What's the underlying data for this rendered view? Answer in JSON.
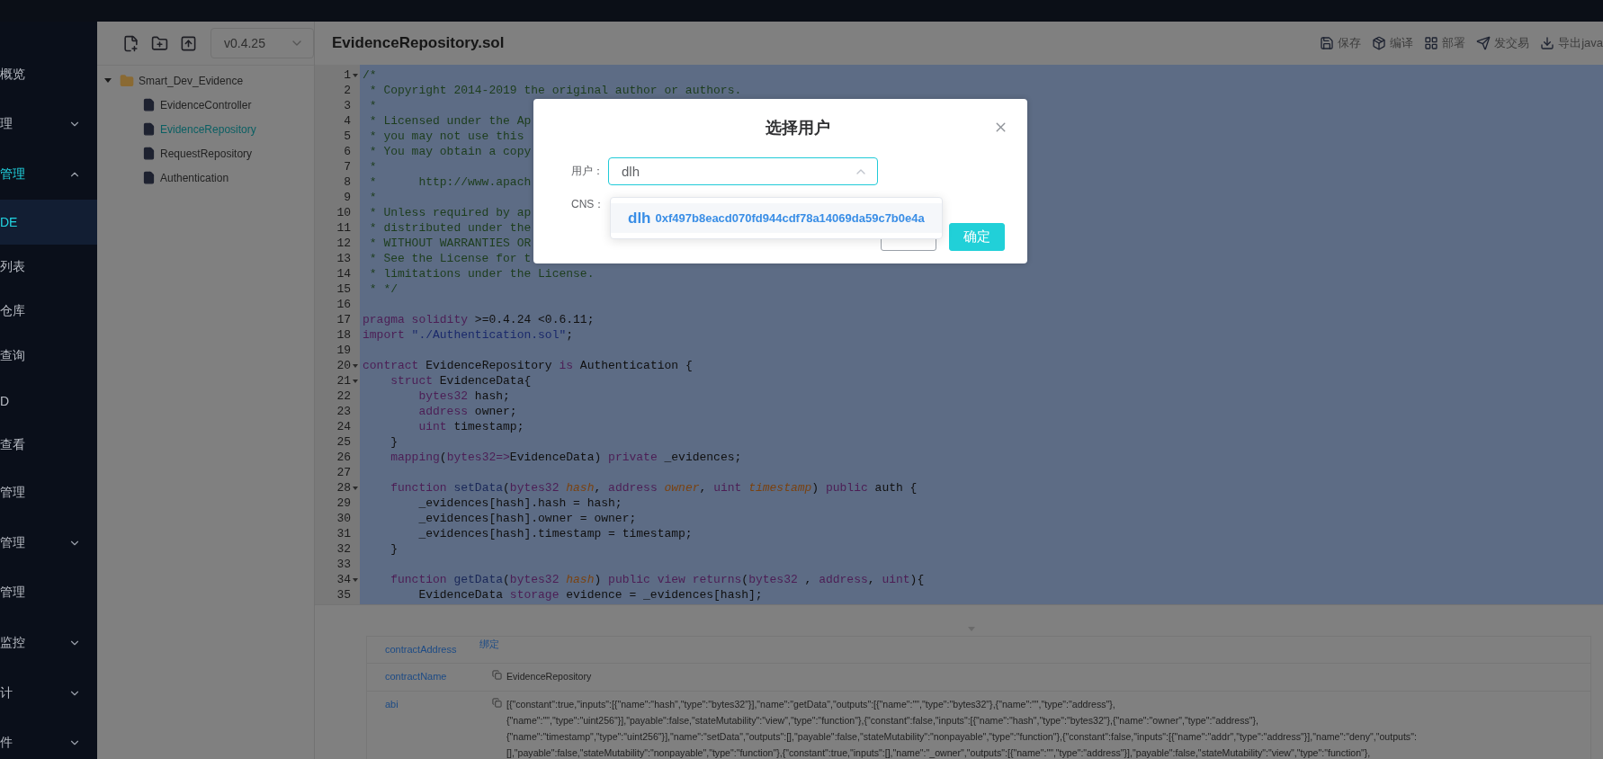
{
  "sidebar": {
    "items": [
      {
        "label": "概览",
        "selected": false
      },
      {
        "label": "理",
        "selected": false,
        "expanded": false
      },
      {
        "label": "管理",
        "selected": false,
        "expanded": true,
        "children": [
          {
            "label": "DE",
            "selected": true
          },
          {
            "label": "列表",
            "selected": false
          },
          {
            "label": "仓库",
            "selected": false
          },
          {
            "label": "查询",
            "selected": false
          },
          {
            "label": "D",
            "selected": false
          },
          {
            "label": "查看",
            "selected": false
          }
        ]
      },
      {
        "label": "管理",
        "selected": false
      },
      {
        "label": "管理",
        "selected": false,
        "expanded": false
      },
      {
        "label": "管理",
        "selected": false
      },
      {
        "label": "监控",
        "selected": false,
        "expanded": false
      },
      {
        "label": "计",
        "selected": false,
        "expanded": false
      },
      {
        "label": "件",
        "selected": false,
        "expanded": false
      }
    ]
  },
  "file_panel": {
    "version": "v0.4.25",
    "tree": [
      {
        "label": "Smart_Dev_Evidence",
        "kind": "folder",
        "expanded": true,
        "children": [
          {
            "label": "EvidenceController",
            "kind": "file",
            "selected": false
          },
          {
            "label": "EvidenceRepository",
            "kind": "file",
            "selected": true
          },
          {
            "label": "RequestRepository",
            "kind": "file",
            "selected": false
          },
          {
            "label": "Authentication",
            "kind": "file",
            "selected": false
          }
        ]
      }
    ]
  },
  "editor": {
    "title": "EvidenceRepository.sol",
    "actions": [
      {
        "kind": "save",
        "label": "保存"
      },
      {
        "kind": "compile",
        "label": "编译"
      },
      {
        "kind": "deploy",
        "label": "部署"
      },
      {
        "kind": "send",
        "label": "发交易"
      },
      {
        "kind": "export",
        "label": "导出java"
      }
    ],
    "lines": [
      {
        "no": "1",
        "fold": true,
        "tokens": [
          {
            "kind": "comment",
            "text": "/*"
          }
        ]
      },
      {
        "no": "2",
        "fold": false,
        "tokens": [
          {
            "kind": "comment",
            "text": " * Copyright 2014-2019 the original author or authors."
          }
        ]
      },
      {
        "no": "3",
        "fold": false,
        "tokens": [
          {
            "kind": "comment",
            "text": " *"
          }
        ]
      },
      {
        "no": "4",
        "fold": false,
        "tokens": [
          {
            "kind": "comment",
            "text": " * Licensed under the Ap"
          }
        ]
      },
      {
        "no": "5",
        "fold": false,
        "tokens": [
          {
            "kind": "comment",
            "text": " * you may not use this"
          }
        ]
      },
      {
        "no": "6",
        "fold": false,
        "tokens": [
          {
            "kind": "comment",
            "text": " * You may obtain a copy"
          }
        ]
      },
      {
        "no": "7",
        "fold": false,
        "tokens": [
          {
            "kind": "comment",
            "text": " *"
          }
        ]
      },
      {
        "no": "8",
        "fold": false,
        "tokens": [
          {
            "kind": "comment",
            "text": " *      http://www.apach"
          }
        ]
      },
      {
        "no": "9",
        "fold": false,
        "tokens": [
          {
            "kind": "comment",
            "text": " *"
          }
        ]
      },
      {
        "no": "10",
        "fold": false,
        "tokens": [
          {
            "kind": "comment",
            "text": " * Unless required by ap"
          }
        ]
      },
      {
        "no": "11",
        "fold": false,
        "tokens": [
          {
            "kind": "comment",
            "text": " * distributed under the"
          }
        ]
      },
      {
        "no": "12",
        "fold": false,
        "tokens": [
          {
            "kind": "comment",
            "text": " * WITHOUT WARRANTIES OR"
          }
        ]
      },
      {
        "no": "13",
        "fold": false,
        "tokens": [
          {
            "kind": "comment",
            "text": " * See the License for t"
          }
        ]
      },
      {
        "no": "14",
        "fold": false,
        "tokens": [
          {
            "kind": "comment",
            "text": " * limitations under the License."
          }
        ]
      },
      {
        "no": "15",
        "fold": false,
        "tokens": [
          {
            "kind": "comment",
            "text": " * */"
          }
        ]
      },
      {
        "no": "16",
        "fold": false
      },
      {
        "no": "17",
        "fold": false,
        "tokens": [
          {
            "kind": "keyword",
            "text": "pragma solidity"
          },
          {
            "kind": "plain",
            "text": " >=0.4.24 <0.6.11;"
          }
        ]
      },
      {
        "no": "18",
        "fold": false,
        "tokens": [
          {
            "kind": "keyword",
            "text": "import"
          },
          {
            "kind": "string",
            "text": " \"./Authentication.sol\""
          },
          {
            "kind": "plain",
            "text": ";"
          }
        ]
      },
      {
        "no": "19",
        "fold": false
      },
      {
        "no": "20",
        "fold": true,
        "tokens": [
          {
            "kind": "keyword",
            "text": "contract"
          },
          {
            "kind": "plain",
            "text": " EvidenceRepository "
          },
          {
            "kind": "keyword",
            "text": "is"
          },
          {
            "kind": "plain",
            "text": " Authentication {"
          }
        ]
      },
      {
        "no": "21",
        "fold": true,
        "tokens": [
          {
            "kind": "keyword",
            "text": "    struct"
          },
          {
            "kind": "plain",
            "text": " EvidenceData{"
          }
        ]
      },
      {
        "no": "22",
        "fold": false,
        "tokens": [
          {
            "kind": "keyword",
            "text": "        bytes32"
          },
          {
            "kind": "plain",
            "text": " hash;"
          }
        ]
      },
      {
        "no": "23",
        "fold": false,
        "tokens": [
          {
            "kind": "keyword",
            "text": "        address"
          },
          {
            "kind": "plain",
            "text": " owner;"
          }
        ]
      },
      {
        "no": "24",
        "fold": false,
        "tokens": [
          {
            "kind": "keyword",
            "text": "        uint"
          },
          {
            "kind": "plain",
            "text": " timestamp;"
          }
        ]
      },
      {
        "no": "25",
        "fold": false,
        "tokens": [
          {
            "kind": "plain",
            "text": "    }"
          }
        ]
      },
      {
        "no": "26",
        "fold": false,
        "tokens": [
          {
            "kind": "keyword",
            "text": "    mapping"
          },
          {
            "kind": "plain",
            "text": "("
          },
          {
            "kind": "keyword",
            "text": "bytes32=>"
          },
          {
            "kind": "plain",
            "text": "EvidenceData) "
          },
          {
            "kind": "keyword",
            "text": "private"
          },
          {
            "kind": "plain",
            "text": " _evidences;"
          }
        ]
      },
      {
        "no": "27",
        "fold": false
      },
      {
        "no": "28",
        "fold": true,
        "tokens": [
          {
            "kind": "keyword",
            "text": "    function"
          },
          {
            "kind": "function",
            "text": " setData"
          },
          {
            "kind": "plain",
            "text": "("
          },
          {
            "kind": "keyword",
            "text": "bytes32"
          },
          {
            "kind": "param",
            "text": " hash"
          },
          {
            "kind": "plain",
            "text": ", "
          },
          {
            "kind": "keyword",
            "text": "address"
          },
          {
            "kind": "param",
            "text": " owner"
          },
          {
            "kind": "plain",
            "text": ", "
          },
          {
            "kind": "keyword",
            "text": "uint"
          },
          {
            "kind": "param",
            "text": " timestamp"
          },
          {
            "kind": "plain",
            "text": ") "
          },
          {
            "kind": "keyword",
            "text": "public"
          },
          {
            "kind": "plain",
            "text": " auth {"
          }
        ]
      },
      {
        "no": "29",
        "fold": false,
        "tokens": [
          {
            "kind": "plain",
            "text": "        _evidences[hash].hash = hash;"
          }
        ]
      },
      {
        "no": "30",
        "fold": false,
        "tokens": [
          {
            "kind": "plain",
            "text": "        _evidences[hash].owner = owner;"
          }
        ]
      },
      {
        "no": "31",
        "fold": false,
        "tokens": [
          {
            "kind": "plain",
            "text": "        _evidences[hash].timestamp = timestamp;"
          }
        ]
      },
      {
        "no": "32",
        "fold": false,
        "tokens": [
          {
            "kind": "plain",
            "text": "    }"
          }
        ]
      },
      {
        "no": "33",
        "fold": false
      },
      {
        "no": "34",
        "fold": true,
        "tokens": [
          {
            "kind": "keyword",
            "text": "    function"
          },
          {
            "kind": "function",
            "text": " getData"
          },
          {
            "kind": "plain",
            "text": "("
          },
          {
            "kind": "keyword",
            "text": "bytes32"
          },
          {
            "kind": "param",
            "text": " hash"
          },
          {
            "kind": "plain",
            "text": ") "
          },
          {
            "kind": "keyword",
            "text": "public view returns"
          },
          {
            "kind": "plain",
            "text": "("
          },
          {
            "kind": "keyword",
            "text": "bytes32"
          },
          {
            "kind": "plain",
            "text": " , "
          },
          {
            "kind": "keyword",
            "text": "address"
          },
          {
            "kind": "plain",
            "text": ", "
          },
          {
            "kind": "keyword",
            "text": "uint"
          },
          {
            "kind": "plain",
            "text": "){"
          }
        ]
      },
      {
        "no": "35",
        "fold": false,
        "tokens": [
          {
            "kind": "plain",
            "text": "        EvidenceData "
          },
          {
            "kind": "keyword",
            "text": "storage"
          },
          {
            "kind": "plain",
            "text": " evidence = _evidences[hash];"
          }
        ]
      }
    ]
  },
  "details": {
    "rows": [
      {
        "label": "contractAddress",
        "kind": "link",
        "value": "绑定"
      },
      {
        "label": "contractName",
        "kind": "copy",
        "value": "EvidenceRepository"
      },
      {
        "label": "abi",
        "kind": "copy",
        "value": "[{\"constant\":true,\"inputs\":[{\"name\":\"hash\",\"type\":\"bytes32\"}],\"name\":\"getData\",\"outputs\":[{\"name\":\"\",\"type\":\"bytes32\"},{\"name\":\"\",\"type\":\"address\"},\n{\"name\":\"\",\"type\":\"uint256\"}],\"payable\":false,\"stateMutability\":\"view\",\"type\":\"function\"},{\"constant\":false,\"inputs\":[{\"name\":\"hash\",\"type\":\"bytes32\"},{\"name\":\"owner\",\"type\":\"address\"},\n{\"name\":\"timestamp\",\"type\":\"uint256\"}],\"name\":\"setData\",\"outputs\":[],\"payable\":false,\"stateMutability\":\"nonpayable\",\"type\":\"function\"},{\"constant\":false,\"inputs\":[{\"name\":\"addr\",\"type\":\"address\"}],\"name\":\"deny\",\"outputs\":\n[],\"payable\":false,\"stateMutability\":\"nonpayable\",\"type\":\"function\"},{\"constant\":true,\"inputs\":[],\"name\":\"_owner\",\"outputs\":[{\"name\":\"\",\"type\":\"address\"}],\"payable\":false,\"stateMutability\":\"view\",\"type\":\"function\"},"
      }
    ]
  },
  "dialog": {
    "title": "选择用户",
    "fields": [
      {
        "label": "用户：",
        "value": "dlh",
        "open": true
      },
      {
        "label": "CNS："
      }
    ],
    "options": [
      {
        "name": "dlh",
        "address": "0xf497b8eacd070fd944cdf78a14069da59c7b0e4a",
        "selected": true
      }
    ],
    "buttons": [
      {
        "kind": "secondary"
      },
      {
        "kind": "primary",
        "label": "确定"
      }
    ]
  }
}
